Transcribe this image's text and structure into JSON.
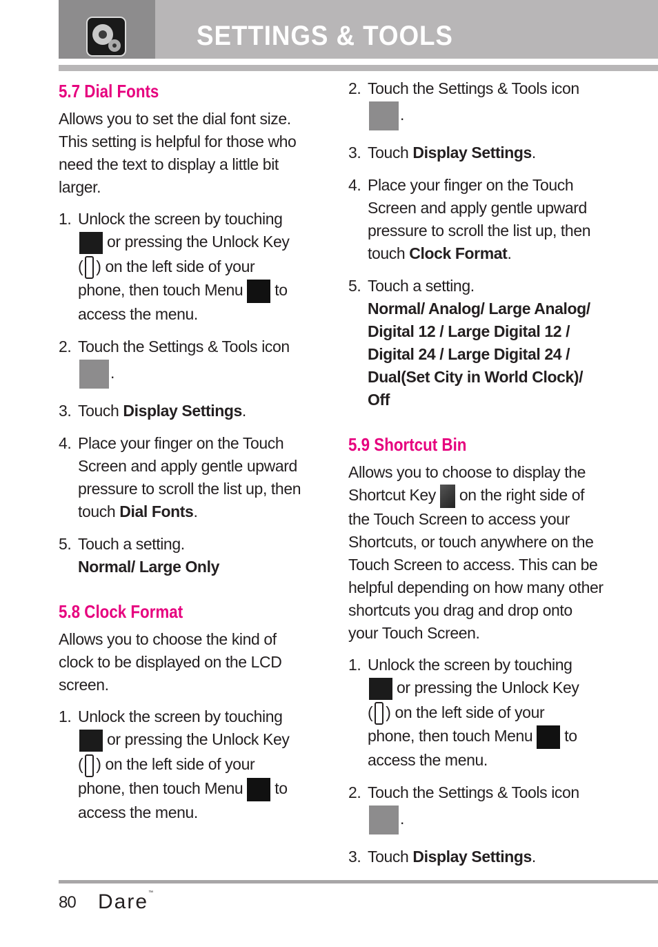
{
  "header": {
    "title": "SETTINGS & TOOLS",
    "icon": "settings-tools-gear-icon",
    "accent_color": "#e6007e"
  },
  "left_column": {
    "dial_fonts": {
      "title": "5.7 Dial Fonts",
      "intro": "Allows you to set the dial font size. This setting is helpful for those who need the text to display a little bit larger.",
      "steps": [
        {
          "num": "1.",
          "text_a": "Unlock the screen by touching",
          "text_b": "or pressing the Unlock Key",
          "text_c": "(",
          "text_d": ") on the left side of your",
          "text_e": "phone, then touch Menu",
          "text_f": "to",
          "text_g": "access the menu."
        },
        {
          "num": "2.",
          "text": "Touch the Settings & Tools icon",
          "suffix": "."
        },
        {
          "num": "3.",
          "prefix": "Touch ",
          "bold": "Display Settings",
          "suffix": "."
        },
        {
          "num": "4.",
          "prefix": "Place your finger on the Touch Screen and apply gentle upward pressure to scroll the list up, then touch ",
          "bold": "Dial Fonts",
          "suffix": "."
        },
        {
          "num": "5.",
          "text": "Touch a setting.",
          "options": "Normal/ Large Only"
        }
      ]
    },
    "clock_format": {
      "title": "5.8 Clock Format",
      "intro": "Allows you to choose the kind of clock to be displayed on the LCD screen.",
      "steps": [
        {
          "num": "1.",
          "text_a": "Unlock the screen by touching",
          "text_b": "or pressing the Unlock Key",
          "text_c": "(",
          "text_d": ") on the left side of your",
          "text_e": "phone, then touch Menu",
          "text_f": "to",
          "text_g": "access the menu."
        }
      ]
    }
  },
  "right_column": {
    "clock_format_cont": {
      "steps": [
        {
          "num": "2.",
          "text": "Touch the Settings & Tools icon",
          "suffix": "."
        },
        {
          "num": "3.",
          "prefix": "Touch ",
          "bold": "Display Settings",
          "suffix": "."
        },
        {
          "num": "4.",
          "prefix": "Place your finger on the Touch Screen and apply gentle upward pressure to scroll the list up, then touch ",
          "bold": "Clock Format",
          "suffix": "."
        },
        {
          "num": "5.",
          "text": "Touch a setting.",
          "options": "Normal/ Analog/ Large Analog/ Digital 12 / Large Digital 12 / Digital 24 / Large Digital 24 / Dual(Set City in World Clock)/ Off"
        }
      ]
    },
    "shortcut_bin": {
      "title": "5.9 Shortcut Bin",
      "intro_a": "Allows you to choose to display the Shortcut Key",
      "intro_b": "on the right side of the Touch Screen to access your Shortcuts, or touch anywhere on the Touch Screen to access. This can be helpful depending on how many other shortcuts you drag and drop onto your Touch Screen.",
      "steps": [
        {
          "num": "1.",
          "text_a": "Unlock the screen by touching",
          "text_b": "or pressing the Unlock Key",
          "text_c": "(",
          "text_d": ") on the left side of your",
          "text_e": "phone, then touch Menu",
          "text_f": "to",
          "text_g": "access the menu."
        },
        {
          "num": "2.",
          "text": "Touch the Settings & Tools icon",
          "suffix": "."
        },
        {
          "num": "3.",
          "prefix": "Touch ",
          "bold": "Display Settings",
          "suffix": "."
        }
      ]
    }
  },
  "footer": {
    "page_number": "80",
    "brand": "Dare",
    "trademark": "™"
  }
}
